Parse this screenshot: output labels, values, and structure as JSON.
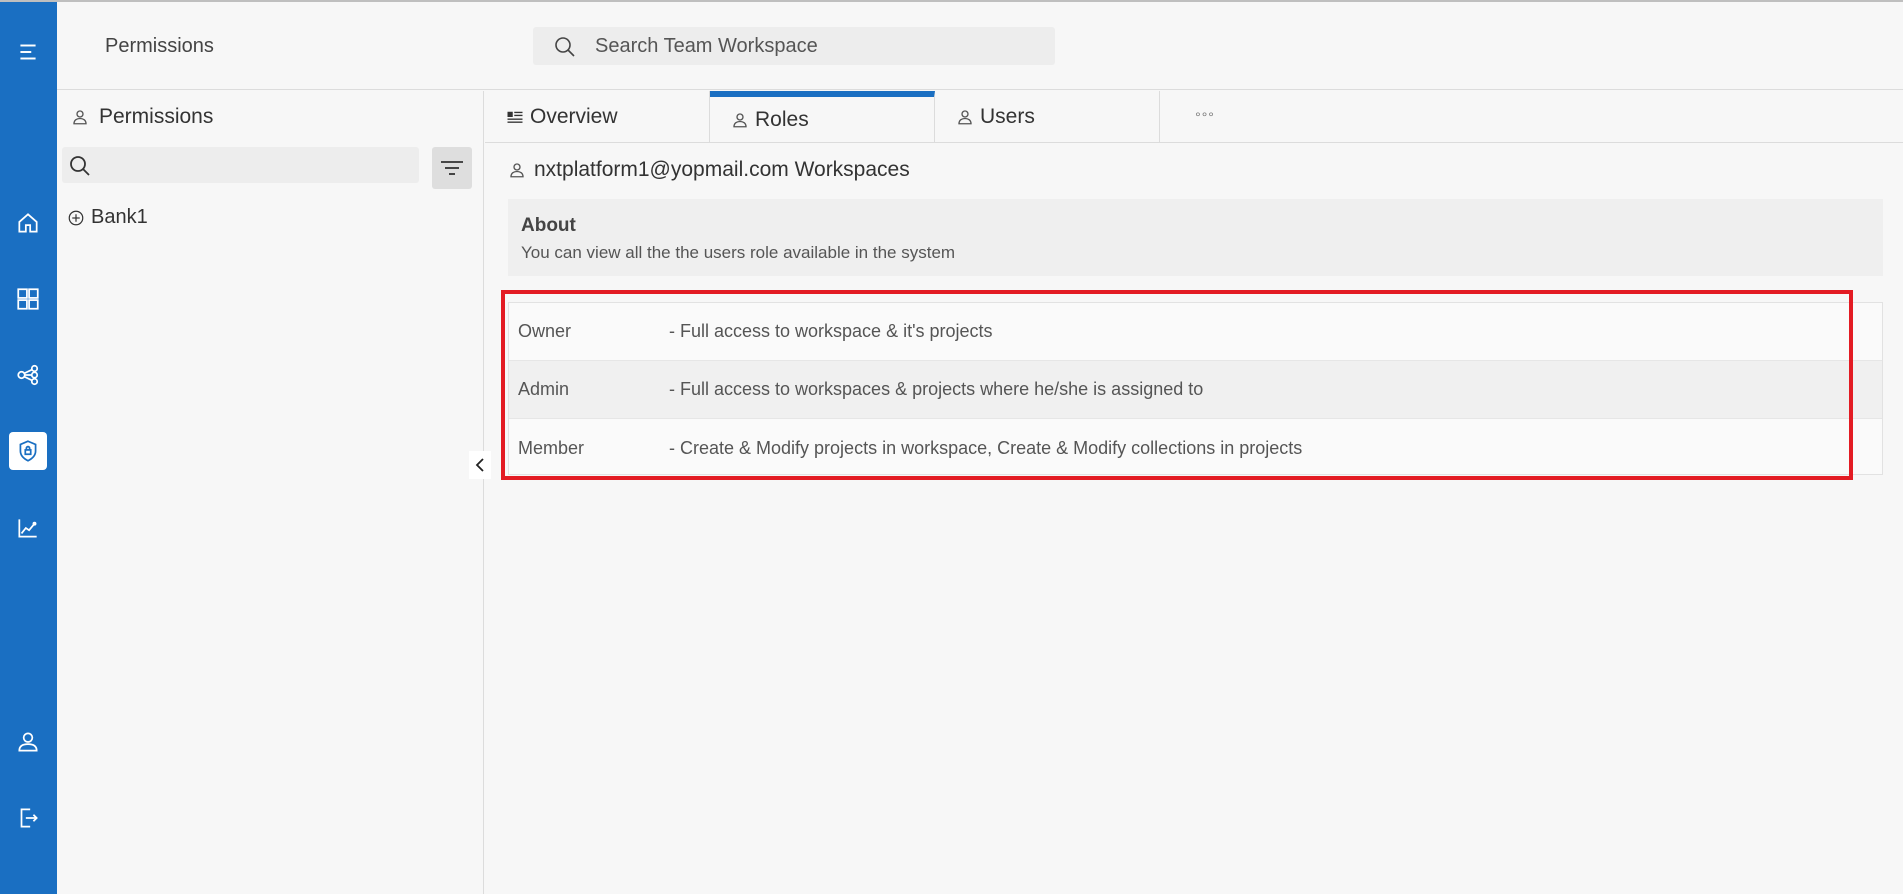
{
  "header": {
    "title": "Permissions",
    "search_placeholder": "Search Team Workspace"
  },
  "rail": {
    "items": [
      "menu-icon",
      "home-icon",
      "dashboard-icon",
      "share-nodes-icon",
      "shield-lock-icon",
      "analytics-icon",
      "user-icon",
      "logout-icon"
    ],
    "active": "shield-lock-icon",
    "color": "#1a6fc2"
  },
  "panel": {
    "title": "Permissions",
    "search_placeholder": "",
    "tree": [
      {
        "label": "Bank1"
      }
    ]
  },
  "tabs": [
    {
      "label": "Overview",
      "icon": "overview-icon"
    },
    {
      "label": "Roles",
      "icon": "user-icon",
      "active": true
    },
    {
      "label": "Users",
      "icon": "user-icon"
    }
  ],
  "tabs_more": "°°°",
  "workspace": {
    "title": "nxtplatform1@yopmail.com Workspaces"
  },
  "about": {
    "title": "About",
    "text": "You can view all the the users role available in the system"
  },
  "roles": [
    {
      "name": "Owner",
      "description": "- Full access to workspace & it's projects"
    },
    {
      "name": "Admin",
      "description": "- Full access to workspaces & projects where he/she is assigned to"
    },
    {
      "name": "Member",
      "description": "- Create & Modify projects in workspace, Create & Modify collections in projects"
    }
  ],
  "highlight_color": "#e31b23"
}
